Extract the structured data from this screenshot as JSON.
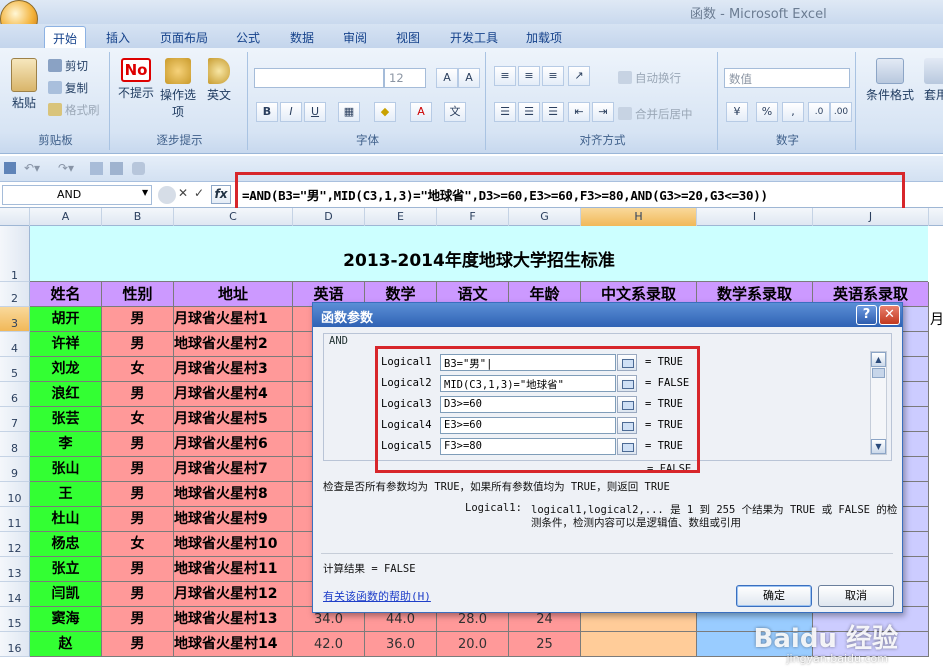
{
  "window": {
    "title": "函数 - Microsoft Excel"
  },
  "tabs": [
    "开始",
    "插入",
    "页面布局",
    "公式",
    "数据",
    "审阅",
    "视图",
    "开发工具",
    "加载项"
  ],
  "ribbon": {
    "clipboard": {
      "label": "剪贴板",
      "paste": "粘贴",
      "cut": "剪切",
      "copy": "复制",
      "format_painter": "格式刷"
    },
    "hint": {
      "label": "逐步提示",
      "no_hint": "不提示",
      "op": "操作选项",
      "en": "英文"
    },
    "font": {
      "label": "字体",
      "size": "12"
    },
    "align": {
      "label": "对齐方式",
      "wrap": "自动换行",
      "merge": "合并后居中"
    },
    "number": {
      "label": "数字",
      "format": "数值",
      "pct": "%"
    },
    "styles": {
      "cond": "条件格式",
      "table": "套用表格格式"
    }
  },
  "formula_bar": {
    "name_box": "AND",
    "formula": "=AND(B3=\"男\",MID(C3,1,3)=\"地球省\",D3>=60,E3>=60,F3>=80,AND(G3>=20,G3<=30))"
  },
  "columns": [
    "A",
    "B",
    "C",
    "D",
    "E",
    "F",
    "G",
    "H",
    "I",
    "J"
  ],
  "rows": [
    "1",
    "2",
    "3",
    "4",
    "5",
    "6",
    "7",
    "8",
    "9",
    "10",
    "11",
    "12",
    "13",
    "14",
    "15",
    "16"
  ],
  "sheet": {
    "title": "2013-2014年度地球大学招生标准",
    "headers": [
      "姓名",
      "性别",
      "地址",
      "英语",
      "数学",
      "语文",
      "年龄",
      "中文系录取",
      "数学系录取",
      "英语系录取"
    ],
    "records": [
      [
        "胡开",
        "男",
        "月球省火星村1"
      ],
      [
        "许祥",
        "男",
        "地球省火星村2"
      ],
      [
        "刘龙",
        "女",
        "月球省火星村3"
      ],
      [
        "浪红",
        "男",
        "月球省火星村4"
      ],
      [
        "张芸",
        "女",
        "月球省火星村5"
      ],
      [
        "李",
        "男",
        "月球省火星村6"
      ],
      [
        "张山",
        "男",
        "月球省火星村7"
      ],
      [
        "王",
        "男",
        "地球省火星村8"
      ],
      [
        "杜山",
        "男",
        "地球省火星村9"
      ],
      [
        "杨忠",
        "女",
        "地球省火星村10"
      ],
      [
        "张立",
        "男",
        "地球省火星村11"
      ],
      [
        "闫凯",
        "男",
        "月球省火星村12"
      ],
      [
        "窦海",
        "男",
        "地球省火星村13"
      ],
      [
        "赵",
        "男",
        "地球省火星村14"
      ]
    ],
    "visible_scores": [
      [
        "34.0",
        "44.0",
        "28.0",
        "24"
      ],
      [
        "42.0",
        "36.0",
        "20.0",
        "25"
      ]
    ],
    "partial_right_cell": "月"
  },
  "dialog": {
    "title": "函数参数",
    "function_name": "AND",
    "args": [
      {
        "label": "Logical1",
        "value": "B3=\"男\"|",
        "result": "= TRUE"
      },
      {
        "label": "Logical2",
        "value": "MID(C3,1,3)=\"地球省\"",
        "result": "= FALSE"
      },
      {
        "label": "Logical3",
        "value": "D3>=60",
        "result": "= TRUE"
      },
      {
        "label": "Logical4",
        "value": "E3>=60",
        "result": "= TRUE"
      },
      {
        "label": "Logical5",
        "value": "F3>=80",
        "result": "= TRUE"
      }
    ],
    "overall_result": "= FALSE",
    "description": "检查是否所有参数均为 TRUE，如果所有参数值均为 TRUE，则返回 TRUE",
    "arg_help_label": "Logical1:",
    "arg_help_line1": "logical1,logical2,... 是 1 到 255 个结果为 TRUE 或 FALSE 的检",
    "arg_help_line2": "测条件，检测内容可以是逻辑值、数组或引用",
    "calc_result": "计算结果 = FALSE",
    "help_link": "有关该函数的帮助(H)",
    "ok": "确定",
    "cancel": "取消"
  },
  "watermark": {
    "brand": "Baidu 经验",
    "url": "jingyan.baidu.com"
  },
  "colors": {
    "name_cell": "#33ff33",
    "gender_cell": "#ff9999",
    "address_cell": "#ff9999",
    "header_fill": "#cc99ff",
    "title_fill": "#ccffff",
    "score_fill": "#ff9999",
    "h_col": "#ffcc99",
    "i_col": "#99ccff",
    "j_col": "#ccccff",
    "highlight_border": "#d7262b"
  }
}
